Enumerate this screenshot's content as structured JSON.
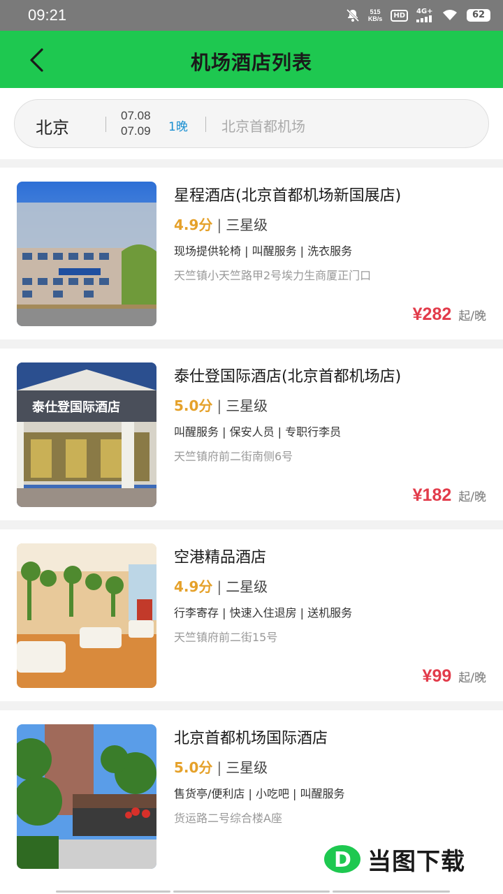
{
  "status_bar": {
    "time": "09:21",
    "speed_value": "515",
    "speed_unit": "KB/s",
    "hd": "HD",
    "network": "4G+",
    "battery": "62"
  },
  "header": {
    "title": "机场酒店列表",
    "back_icon": "chevron-left-icon",
    "bg_color": "#1ec850"
  },
  "search": {
    "city": "北京",
    "checkin": "07.08",
    "checkout": "07.09",
    "nights": "1晚",
    "location_placeholder": "北京首都机场"
  },
  "hotels": [
    {
      "name": "星程酒店(北京首都机场新国展店)",
      "score": "4.9分",
      "sep": "|",
      "star": "三星级",
      "facilities": "现场提供轮椅 | 叫醒服务 | 洗衣服务",
      "address": "天竺镇小天竺路甲2号埃力生商厦正门口",
      "price": "¥282",
      "unit": "起/晚"
    },
    {
      "name": "泰仕登国际酒店(北京首都机场店)",
      "score": "5.0分",
      "sep": "|",
      "star": "三星级",
      "facilities": "叫醒服务 | 保安人员 | 专职行李员",
      "address": "天竺镇府前二街南侧6号",
      "price": "¥182",
      "unit": "起/晚",
      "sign_text": "泰仕登国际酒店"
    },
    {
      "name": "空港精品酒店",
      "score": "4.9分",
      "sep": "|",
      "star": "二星级",
      "facilities": "行李寄存 | 快速入住退房 | 送机服务",
      "address": "天竺镇府前二街15号",
      "price": "¥99",
      "unit": "起/晚"
    },
    {
      "name": "北京首都机场国际酒店",
      "score": "5.0分",
      "sep": "|",
      "star": "三星级",
      "facilities": "售货亭/便利店 | 小吃吧 | 叫醒服务",
      "address": "货运路二号综合楼A座",
      "price": "",
      "unit": ""
    }
  ],
  "watermark": {
    "letter": "D",
    "text": "当图下载"
  },
  "colors": {
    "accent": "#1ec850",
    "price": "#e23b4a",
    "score": "#e5a12a",
    "nights": "#1a8fd1"
  }
}
